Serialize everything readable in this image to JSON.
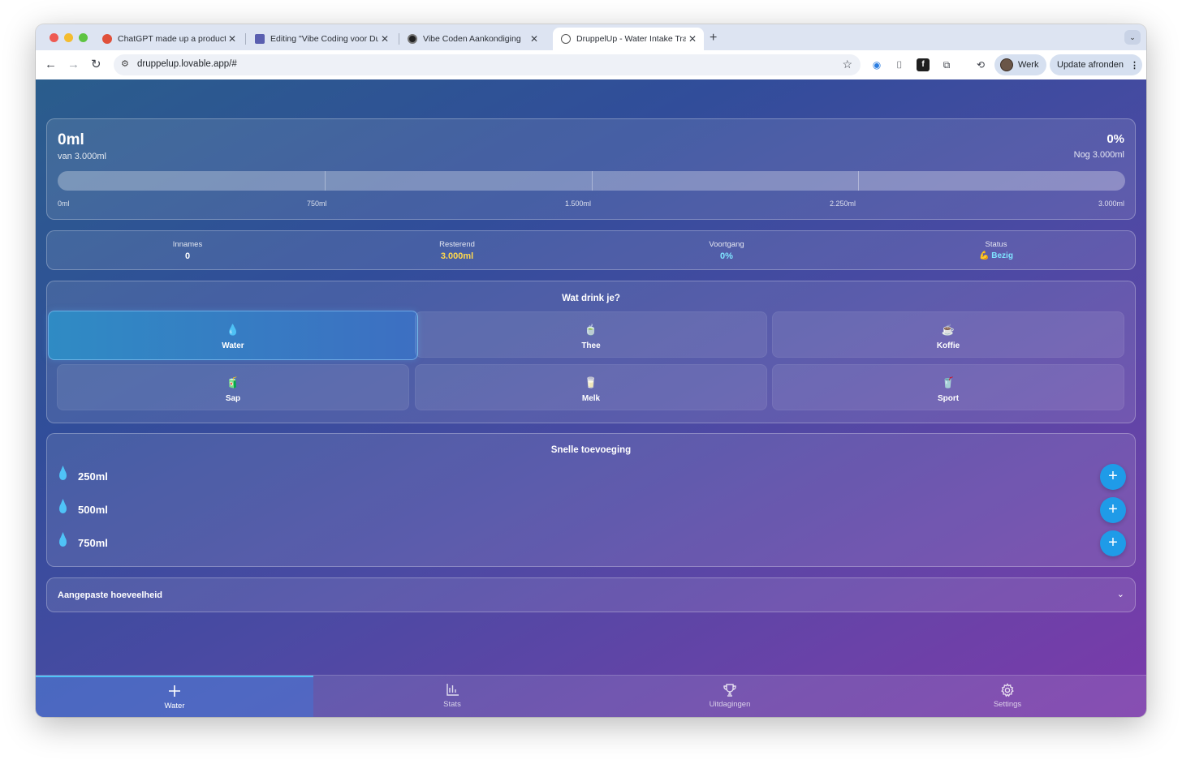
{
  "browser": {
    "tabs": [
      {
        "title": "ChatGPT made up a product",
        "favicon_color": "#e0503a"
      },
      {
        "title": "Editing \"Vibe Coding voor Du",
        "favicon_color": "#5a5fb0"
      },
      {
        "title": "Vibe Coden Aankondiging",
        "favicon_color": "#222222"
      },
      {
        "title": "DruppelUp - Water Intake Tra",
        "favicon_color": "#555555"
      }
    ],
    "url": "druppelup.lovable.app/#",
    "profile_name": "Werk",
    "update_label": "Update afronden"
  },
  "progress": {
    "amount": "0ml",
    "of_label": "van 3.000ml",
    "percent": "0%",
    "remaining_label": "Nog 3.000ml",
    "fill_fraction": 0,
    "scale_labels": [
      "0ml",
      "750ml",
      "1.500ml",
      "2.250ml",
      "3.000ml"
    ]
  },
  "stats": [
    {
      "label": "Innames",
      "value": "0",
      "color": "#ffffff"
    },
    {
      "label": "Resterend",
      "value": "3.000ml",
      "color": "#ffd84d"
    },
    {
      "label": "Voortgang",
      "value": "0%",
      "color": "#7fe3ff"
    },
    {
      "label": "Status",
      "value": "💪 Bezig",
      "color": "#7fe3ff"
    }
  ],
  "drinks": {
    "title": "Wat drink je?",
    "items": [
      {
        "label": "Water",
        "emoji": "💧"
      },
      {
        "label": "Thee",
        "emoji": "🍵"
      },
      {
        "label": "Koffie",
        "emoji": "☕"
      },
      {
        "label": "Sap",
        "emoji": "🧃"
      },
      {
        "label": "Melk",
        "emoji": "🥛"
      },
      {
        "label": "Sport",
        "emoji": "🥤"
      }
    ],
    "selected": "Water"
  },
  "quick_add": {
    "title": "Snelle toevoeging",
    "items": [
      "250ml",
      "500ml",
      "750ml"
    ],
    "button_icon": "plus-icon"
  },
  "custom": {
    "label": "Aangepaste hoeveelheid",
    "icon": "chevron-down-icon"
  },
  "nav": [
    {
      "label": "Water",
      "icon": "plus-icon"
    },
    {
      "label": "Stats",
      "icon": "bar-chart-icon"
    },
    {
      "label": "Uitdagingen",
      "icon": "trophy-icon"
    },
    {
      "label": "Settings",
      "icon": "gear-icon"
    }
  ],
  "colors": {
    "accent": "#1f9be8",
    "progress_fill": "#4fc3f7",
    "gradient_start": "#2a5d8c",
    "gradient_end": "#7b3aaa"
  }
}
